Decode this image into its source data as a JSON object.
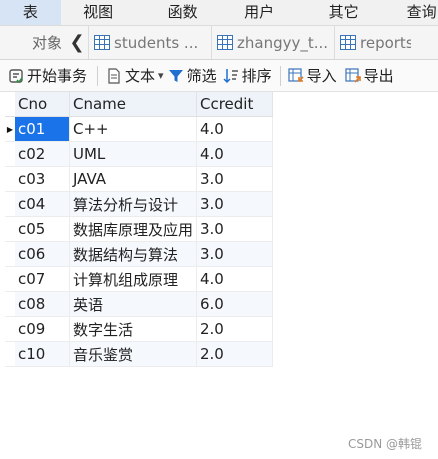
{
  "menu": {
    "items": [
      "表",
      "视图",
      "函数",
      "用户",
      "其它",
      "查询"
    ]
  },
  "tabs": {
    "label": "对象",
    "chevron": "❮",
    "items": [
      "students ...",
      "zhangyy_t...",
      "reports"
    ]
  },
  "toolbar": {
    "begin_transaction": "开始事务",
    "text": "文本",
    "text_caret": "▾",
    "filter": "筛选",
    "sort": "排序",
    "import": "导入",
    "export": "导出"
  },
  "table": {
    "columns": [
      "Cno",
      "Cname",
      "Ccredit"
    ],
    "current_row_marker": "▶",
    "rows": [
      [
        "c01",
        "C++",
        "4.0"
      ],
      [
        "c02",
        "UML",
        "4.0"
      ],
      [
        "c03",
        "JAVA",
        "3.0"
      ],
      [
        "c04",
        "算法分析与设计",
        "3.0"
      ],
      [
        "c05",
        "数据库原理及应用",
        "3.0"
      ],
      [
        "c06",
        "数据结构与算法",
        "3.0"
      ],
      [
        "c07",
        "计算机组成原理",
        "4.0"
      ],
      [
        "c08",
        "英语",
        "6.0"
      ],
      [
        "c09",
        "数字生活",
        "2.0"
      ],
      [
        "c10",
        "音乐鉴赏",
        "2.0"
      ]
    ]
  },
  "watermark": "CSDN @韩锟",
  "colors": {
    "selection": "#1a73e8",
    "header_bg": "#eef3fa",
    "icon_blue": "#3b73b9",
    "filter_blue": "#1f6fd1",
    "import_orange": "#e07b24"
  }
}
